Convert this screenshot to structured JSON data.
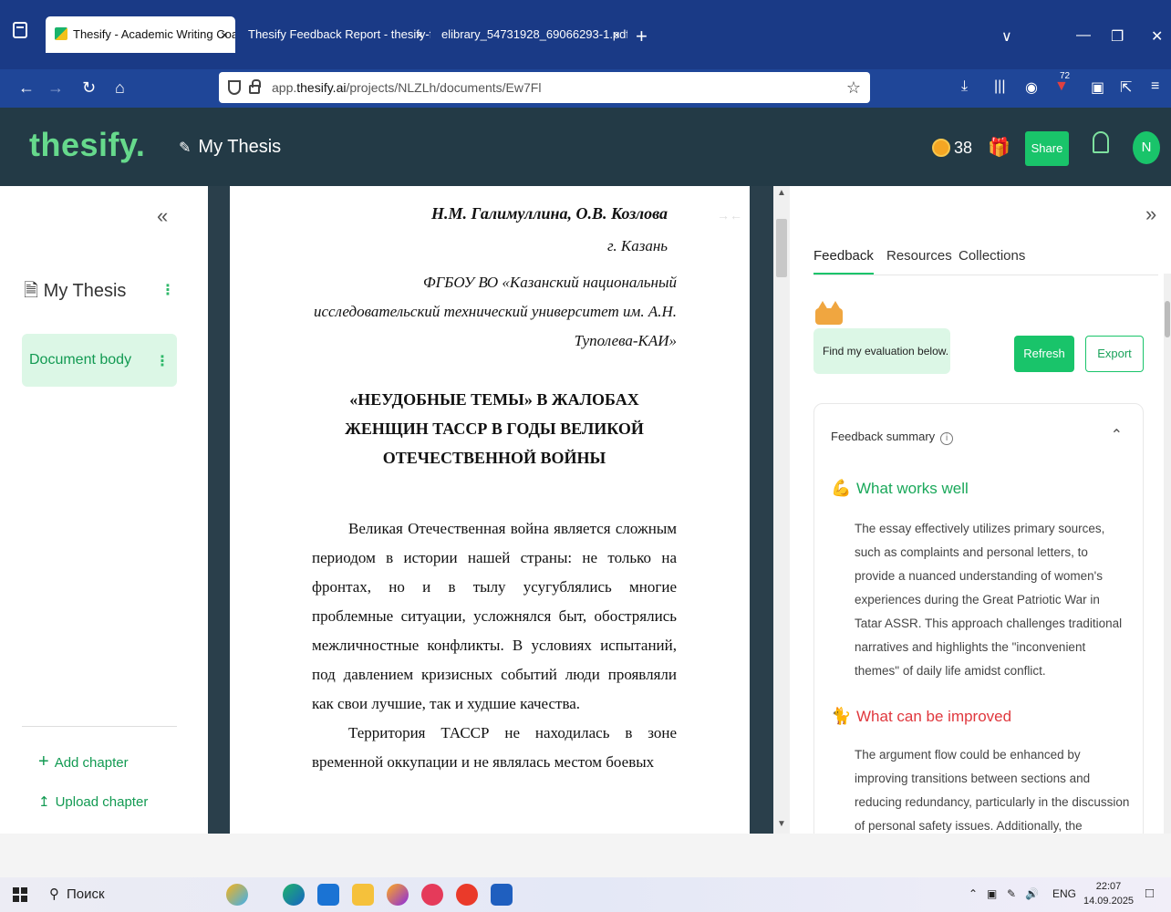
{
  "browser": {
    "tabs": [
      {
        "label": "Thesify - Academic Writing Coa",
        "active": true
      },
      {
        "label": "Thesify Feedback Report - thesify-fe",
        "active": false
      },
      {
        "label": "elibrary_54731928_69066293-1.pdf",
        "active": false
      }
    ],
    "close_glyph": "×",
    "new_tab_glyph": "+",
    "url_prefix": "app.",
    "url_domain": "thesify.ai",
    "url_path": "/projects/NLZLh/documents/Ew7Fl",
    "badge_count": "72"
  },
  "app": {
    "logo": "thesify.",
    "project_title": "My Thesis",
    "credits": "38",
    "share_label": "Share",
    "avatar_initial": "N"
  },
  "sidebar": {
    "collapse_glyph": "«",
    "project_label": "My Thesis",
    "items": [
      {
        "label": "Document body",
        "selected": true
      }
    ],
    "add_chapter": "Add chapter",
    "upload_chapter": "Upload chapter"
  },
  "document": {
    "authors": "Н.М. Галимуллина, О.В. Козлова",
    "city": "г. Казань",
    "affiliation": "ФГБОУ ВО «Казанский национальный исследовательский технический университет им. А.Н. Туполева-КАИ»",
    "title": "«НЕУДОБНЫЕ ТЕМЫ» В ЖАЛОБАХ ЖЕНЩИН ТАССР В ГОДЫ ВЕЛИКОЙ ОТЕЧЕСТВЕННОЙ ВОЙНЫ",
    "paragraph1": "Великая Отечественная война является сложным периодом в истории нашей страны: не только на фронтах, но и в тылу усугублялись многие проблемные ситуации, усложнялся быт, обострялись межличностные конфликты. В условиях испытаний, под давлением кризисных событий люди проявляли как свои лучшие, так и худшие качества.",
    "paragraph2": "Территория ТАССР не находилась в зоне временной оккупации и не являлась местом боевых"
  },
  "feedback_panel": {
    "collapse_glyph": "»",
    "tabs": [
      "Feedback",
      "Resources",
      "Collections"
    ],
    "active_tab": "Feedback",
    "assistant_message": "Find my evaluation below.",
    "refresh_label": "Refresh",
    "export_label": "Export",
    "summary_title": "Feedback summary",
    "works_well_title": "What works well",
    "works_well_text": "The essay effectively utilizes primary sources, such as complaints and personal letters, to provide a nuanced understanding of women's experiences during the Great Patriotic War in Tatar ASSR. This approach challenges traditional narratives and highlights the \"inconvenient themes\" of daily life amidst conflict.",
    "improve_title": "What can be improved",
    "improve_text": "The argument flow could be enhanced by improving transitions between sections and reducing redundancy, particularly in the discussion of personal safety issues. Additionally, the"
  },
  "taskbar": {
    "search_label": "Поиск",
    "language": "ENG",
    "time": "22:07",
    "date": "14.09.2025"
  },
  "colors": {
    "brand_green": "#19c46a",
    "header_dark": "#233a46",
    "browser_blue": "#1a3a86",
    "improve_red": "#e0383e"
  }
}
